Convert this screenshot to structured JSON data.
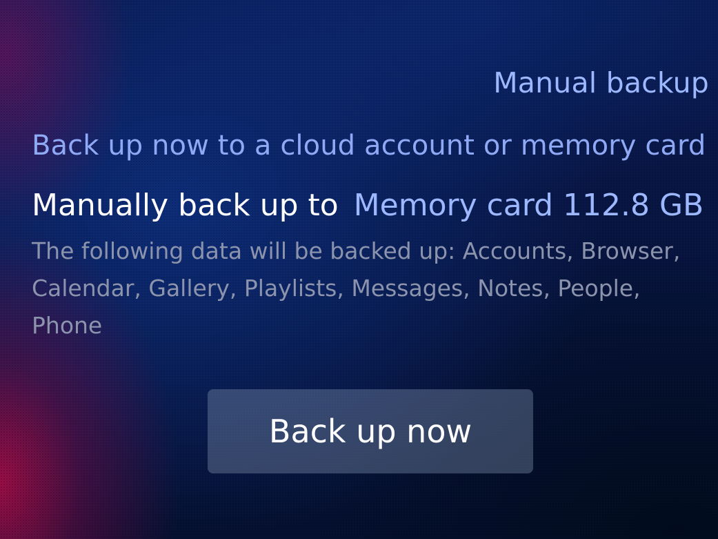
{
  "page": {
    "title": "Manual backup"
  },
  "section": {
    "header": "Back up now to a cloud account or memory card"
  },
  "backup_target": {
    "label": "Manually back up to",
    "value": "Memory card 112.8 GB"
  },
  "description": "The following data will be backed up: Accounts, Browser, Calendar, Gallery, Playlists, Messages, Notes, People, Phone",
  "actions": {
    "backup_now_label": "Back up now"
  },
  "colors": {
    "highlight": "#9db8ff",
    "primary_text": "#ffffff",
    "secondary_text": "#8c93ad"
  }
}
